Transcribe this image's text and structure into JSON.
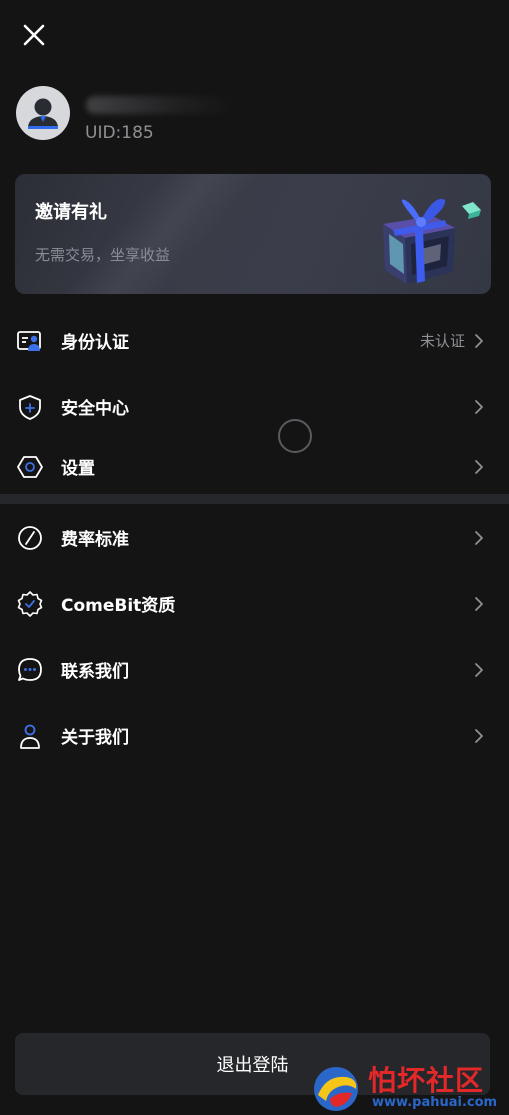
{
  "header": {
    "close_icon": "close-icon"
  },
  "profile": {
    "uid": "UID:185",
    "avatar_icon": "user-avatar-icon"
  },
  "invite_card": {
    "title": "邀请有礼",
    "subtitle": "无需交易，坐享收益",
    "image_icon": "gift-box-icon"
  },
  "menu": {
    "items": [
      {
        "id": "identity",
        "label": "身份认证",
        "value": "未认证",
        "icon": "id-card-icon"
      },
      {
        "id": "security",
        "label": "安全中心",
        "value": "",
        "icon": "shield-icon"
      },
      {
        "id": "settings",
        "label": "设置",
        "value": "",
        "icon": "settings-hexagon-icon"
      },
      {
        "id": "fees",
        "label": "费率标准",
        "value": "",
        "icon": "fee-slash-icon"
      },
      {
        "id": "qualification",
        "label": "ComeBit资质",
        "value": "",
        "icon": "badge-icon"
      },
      {
        "id": "contact",
        "label": "联系我们",
        "value": "",
        "icon": "chat-bubble-icon"
      },
      {
        "id": "about",
        "label": "关于我们",
        "value": "",
        "icon": "person-icon"
      }
    ]
  },
  "logout": {
    "label": "退出登陆"
  },
  "watermark": {
    "title": "怕坏社区",
    "url": "www.pahuai.com"
  },
  "colors": {
    "background": "#141415",
    "card": "#393c47",
    "muted_text": "#8f9094",
    "accent_blue": "#3d6fe8",
    "button": "#26272b",
    "watermark_red": "#e3282a"
  }
}
